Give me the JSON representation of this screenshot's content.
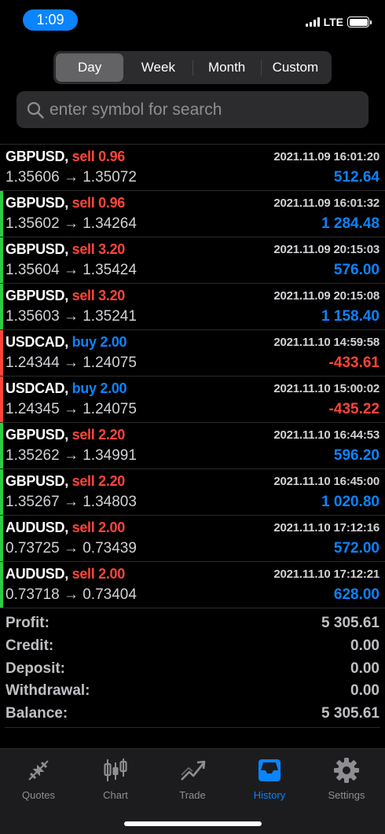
{
  "status": {
    "time": "1:09",
    "network": "LTE"
  },
  "period_tabs": [
    {
      "label": "Day",
      "active": true
    },
    {
      "label": "Week",
      "active": false
    },
    {
      "label": "Month",
      "active": false
    },
    {
      "label": "Custom",
      "active": false
    }
  ],
  "search": {
    "placeholder": "enter symbol for search"
  },
  "deals": [
    {
      "symbol": "GBPUSD,",
      "side": "sell",
      "volume": "0.96",
      "time": "2021.11.09 16:01:20",
      "prices": "1.35606 → 1.35072",
      "profit": "512.64",
      "profit_sign": "pos",
      "bar_color": "#000000"
    },
    {
      "symbol": "GBPUSD,",
      "side": "sell",
      "volume": "0.96",
      "time": "2021.11.09 16:01:32",
      "prices": "1.35602 → 1.34264",
      "profit": "1 284.48",
      "profit_sign": "pos",
      "bar_color": "#2ecc40"
    },
    {
      "symbol": "GBPUSD,",
      "side": "sell",
      "volume": "3.20",
      "time": "2021.11.09 20:15:03",
      "prices": "1.35604 → 1.35424",
      "profit": "576.00",
      "profit_sign": "pos",
      "bar_color": "#2ecc40"
    },
    {
      "symbol": "GBPUSD,",
      "side": "sell",
      "volume": "3.20",
      "time": "2021.11.09 20:15:08",
      "prices": "1.35603 → 1.35241",
      "profit": "1 158.40",
      "profit_sign": "pos",
      "bar_color": "#2ecc40"
    },
    {
      "symbol": "USDCAD,",
      "side": "buy",
      "volume": "2.00",
      "time": "2021.11.10 14:59:58",
      "prices": "1.24344 → 1.24075",
      "profit": "-433.61",
      "profit_sign": "neg",
      "bar_color": "#ff453a"
    },
    {
      "symbol": "USDCAD,",
      "side": "buy",
      "volume": "2.00",
      "time": "2021.11.10 15:00:02",
      "prices": "1.24345 → 1.24075",
      "profit": "-435.22",
      "profit_sign": "neg",
      "bar_color": "#ff453a"
    },
    {
      "symbol": "GBPUSD,",
      "side": "sell",
      "volume": "2.20",
      "time": "2021.11.10 16:44:53",
      "prices": "1.35262 → 1.34991",
      "profit": "596.20",
      "profit_sign": "pos",
      "bar_color": "#2ecc40"
    },
    {
      "symbol": "GBPUSD,",
      "side": "sell",
      "volume": "2.20",
      "time": "2021.11.10 16:45:00",
      "prices": "1.35267 → 1.34803",
      "profit": "1 020.80",
      "profit_sign": "pos",
      "bar_color": "#2ecc40"
    },
    {
      "symbol": "AUDUSD,",
      "side": "sell",
      "volume": "2.00",
      "time": "2021.11.10 17:12:16",
      "prices": "0.73725 → 0.73439",
      "profit": "572.00",
      "profit_sign": "pos",
      "bar_color": "#2ecc40"
    },
    {
      "symbol": "AUDUSD,",
      "side": "sell",
      "volume": "2.00",
      "time": "2021.11.10 17:12:21",
      "prices": "0.73718 → 0.73404",
      "profit": "628.00",
      "profit_sign": "pos",
      "bar_color": "#2ecc40"
    }
  ],
  "summary": [
    {
      "label": "Profit:",
      "value": "5 305.61"
    },
    {
      "label": "Credit:",
      "value": "0.00"
    },
    {
      "label": "Deposit:",
      "value": "0.00"
    },
    {
      "label": "Withdrawal:",
      "value": "0.00"
    },
    {
      "label": "Balance:",
      "value": "5 305.61"
    }
  ],
  "tabbar": [
    {
      "label": "Quotes",
      "icon": "quotes-icon",
      "active": false
    },
    {
      "label": "Chart",
      "icon": "candlestick-chart-icon",
      "active": false
    },
    {
      "label": "Trade",
      "icon": "trade-trend-icon",
      "active": false
    },
    {
      "label": "History",
      "icon": "inbox-history-icon",
      "active": true
    },
    {
      "label": "Settings",
      "icon": "gear-icon",
      "active": false
    }
  ],
  "colors": {
    "accent": "#0a84ff",
    "sell": "#ff453a",
    "buy": "#0a84ff",
    "positive_bar": "#2ecc40"
  }
}
